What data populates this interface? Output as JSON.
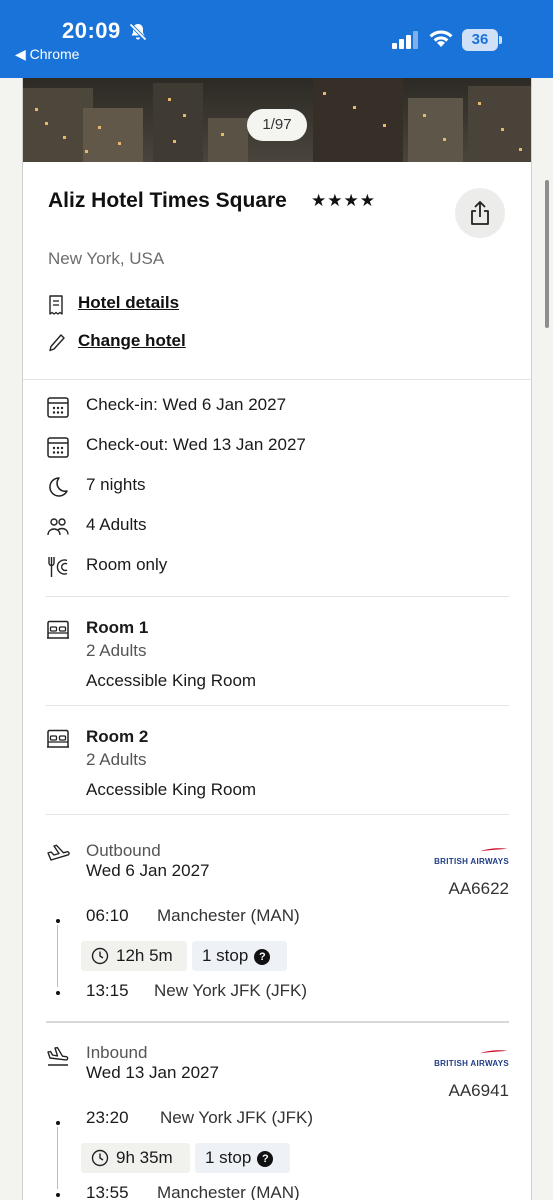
{
  "status_bar": {
    "time": "20:09",
    "back_app": "◀ Chrome",
    "battery": "36",
    "bg_color": "#1a73d9"
  },
  "gallery": {
    "counter": "1/97"
  },
  "hotel": {
    "name": "Aliz Hotel Times Square",
    "stars": "★★★★",
    "star_rating": 4,
    "location": "New York, USA",
    "details_link": "Hotel details",
    "change_link": "Change hotel"
  },
  "stay": {
    "check_in": "Check-in: Wed 6 Jan 2027",
    "check_out": "Check-out: Wed 13 Jan 2027",
    "nights": "7 nights",
    "guests": "4 Adults",
    "board": "Room only"
  },
  "rooms": [
    {
      "title": "Room 1",
      "guests": "2 Adults",
      "type": "Accessible King Room"
    },
    {
      "title": "Room 2",
      "guests": "2 Adults",
      "type": "Accessible King Room"
    }
  ],
  "flights": [
    {
      "direction": "Outbound",
      "date": "Wed 6 Jan 2027",
      "airline": "BRITISH AIRWAYS",
      "code": "AA6622",
      "depart_time": "06:10",
      "depart_place": "Manchester (MAN)",
      "duration": "12h 5m",
      "stops": "1 stop",
      "arrive_time": "13:15",
      "arrive_place": "New York JFK (JFK)"
    },
    {
      "direction": "Inbound",
      "date": "Wed 13 Jan 2027",
      "airline": "BRITISH AIRWAYS",
      "code": "AA6941",
      "depart_time": "23:20",
      "depart_place": "New York JFK (JFK)",
      "duration": "9h 35m",
      "stops": "1 stop",
      "arrive_time": "13:55",
      "arrive_place": "Manchester (MAN)"
    }
  ]
}
